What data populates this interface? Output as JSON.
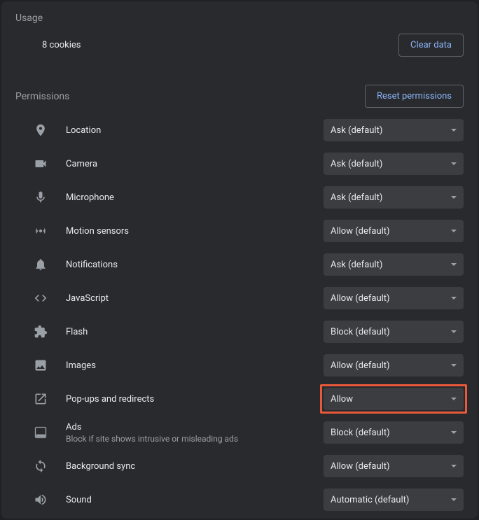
{
  "usage": {
    "section_title": "Usage",
    "cookies_text": "8 cookies",
    "clear_button": "Clear data"
  },
  "permissions": {
    "section_title": "Permissions",
    "reset_button": "Reset permissions",
    "items": [
      {
        "icon": "location",
        "label": "Location",
        "value": "Ask (default)"
      },
      {
        "icon": "camera",
        "label": "Camera",
        "value": "Ask (default)"
      },
      {
        "icon": "microphone",
        "label": "Microphone",
        "value": "Ask (default)"
      },
      {
        "icon": "motion",
        "label": "Motion sensors",
        "value": "Allow (default)"
      },
      {
        "icon": "notifications",
        "label": "Notifications",
        "value": "Ask (default)"
      },
      {
        "icon": "javascript",
        "label": "JavaScript",
        "value": "Allow (default)"
      },
      {
        "icon": "flash",
        "label": "Flash",
        "value": "Block (default)"
      },
      {
        "icon": "images",
        "label": "Images",
        "value": "Allow (default)"
      },
      {
        "icon": "popups",
        "label": "Pop-ups and redirects",
        "value": "Allow",
        "highlight": true
      },
      {
        "icon": "ads",
        "label": "Ads",
        "sublabel": "Block if site shows intrusive or misleading ads",
        "value": "Block (default)"
      },
      {
        "icon": "sync",
        "label": "Background sync",
        "value": "Allow (default)"
      },
      {
        "icon": "sound",
        "label": "Sound",
        "value": "Automatic (default)"
      }
    ]
  }
}
